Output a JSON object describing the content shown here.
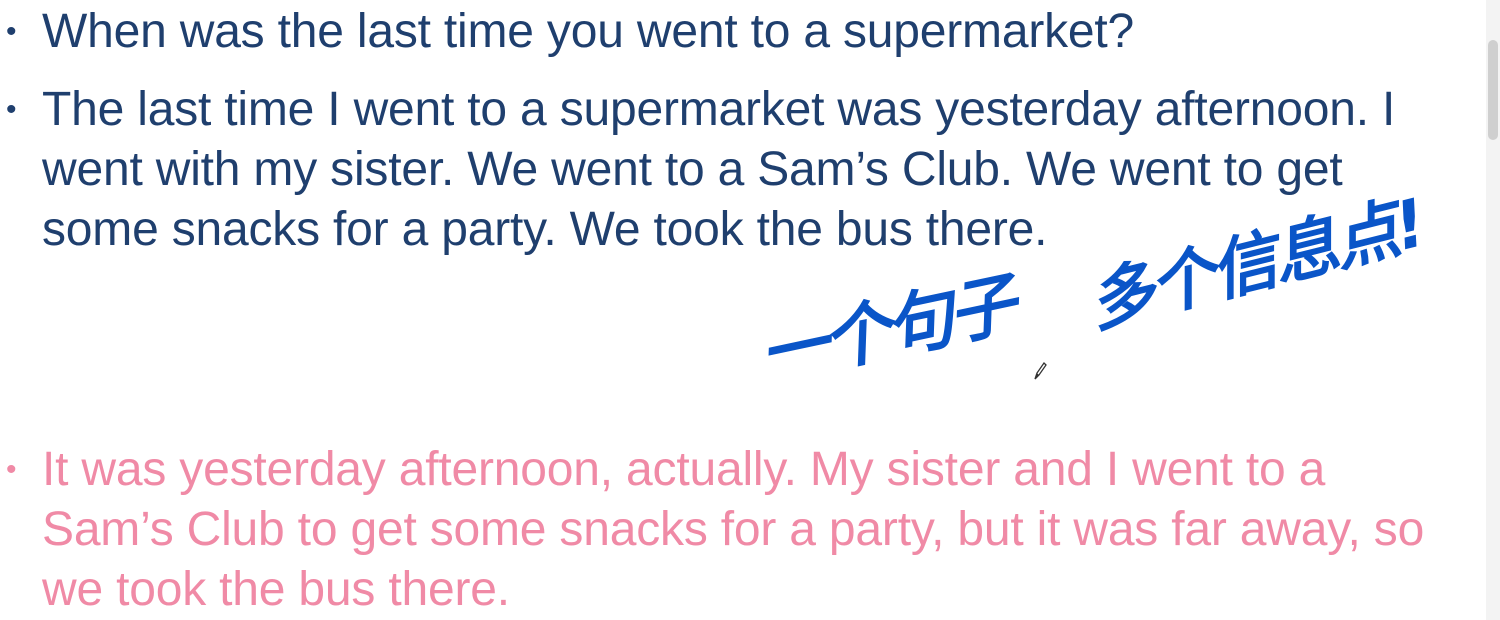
{
  "bullets": [
    {
      "text": "When was the last time you went to a supermarket?",
      "color": "#1f3f6e"
    },
    {
      "text": "The last time I went to a supermarket was yesterday afternoon. I went with my sister. We went to a Sam’s Club. We went to get some snacks for a party. We took the bus there.",
      "color": "#1f3f6e"
    },
    {
      "text": "It was yesterday afternoon, actually. My sister and I went to a Sam’s Club to get some snacks for a party, but it was far away, so we took the bus there.",
      "color": "#f08aa6"
    }
  ],
  "bullet_symbol": "•",
  "annotation": {
    "part1": "一个句子",
    "part2": "多个信息点!",
    "color": "#0a55c8"
  },
  "icons": {
    "pen": "pen-cursor-icon"
  }
}
